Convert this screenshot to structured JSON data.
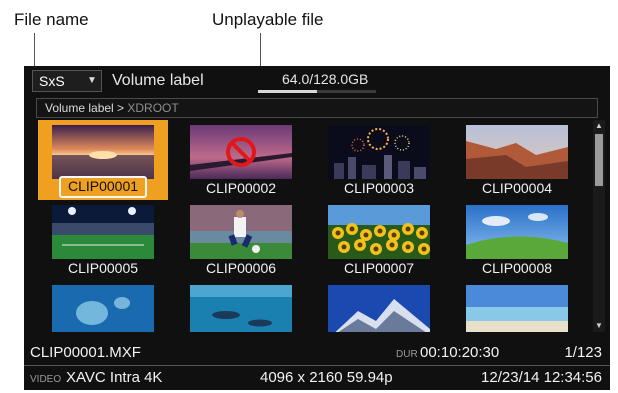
{
  "callouts": {
    "file_name": "File name",
    "unplayable_file": "Unplayable file"
  },
  "header": {
    "media": "SxS",
    "volume_label": "Volume label",
    "capacity": "64.0/128.0GB",
    "capacity_fraction": 0.5
  },
  "path": {
    "parent": "Volume label > ",
    "current": "XDROOT"
  },
  "clips": [
    {
      "label": "CLIP00001",
      "thumbnail": "sunset-sea",
      "selected": true,
      "unplayable": false
    },
    {
      "label": "CLIP00002",
      "thumbnail": "pier-dusk",
      "selected": false,
      "unplayable": true
    },
    {
      "label": "CLIP00003",
      "thumbnail": "fireworks-city",
      "selected": false,
      "unplayable": false
    },
    {
      "label": "CLIP00004",
      "thumbnail": "canyon",
      "selected": false,
      "unplayable": false
    },
    {
      "label": "CLIP00005",
      "thumbnail": "stadium-night",
      "selected": false,
      "unplayable": false
    },
    {
      "label": "CLIP00006",
      "thumbnail": "soccer-player",
      "selected": false,
      "unplayable": false
    },
    {
      "label": "CLIP00007",
      "thumbnail": "sunflowers",
      "selected": false,
      "unplayable": false
    },
    {
      "label": "CLIP00008",
      "thumbnail": "green-hill",
      "selected": false,
      "unplayable": false
    },
    {
      "label": "",
      "thumbnail": "jellyfish",
      "selected": false,
      "unplayable": false
    },
    {
      "label": "",
      "thumbnail": "dolphins",
      "selected": false,
      "unplayable": false
    },
    {
      "label": "",
      "thumbnail": "snow-mountain",
      "selected": false,
      "unplayable": false
    },
    {
      "label": "",
      "thumbnail": "beach",
      "selected": false,
      "unplayable": false
    }
  ],
  "info": {
    "file_name": "CLIP00001.MXF",
    "duration_tag": "DUR",
    "duration": "00:10:20:30",
    "count": "1/123",
    "video_tag": "VIDEO",
    "codec": "XAVC Intra 4K",
    "format": "4096 x 2160 59.94p",
    "datetime": "12/23/14 12:34:56"
  },
  "icons": {
    "media_dropdown": "caret-down-icon",
    "unplayable": "prohibited-icon",
    "scroll_up": "scroll-up-arrow-icon",
    "scroll_down": "scroll-down-arrow-icon"
  },
  "colors": {
    "selection": "#f0a020",
    "prohibited": "#e0181b",
    "background": "#101010"
  }
}
